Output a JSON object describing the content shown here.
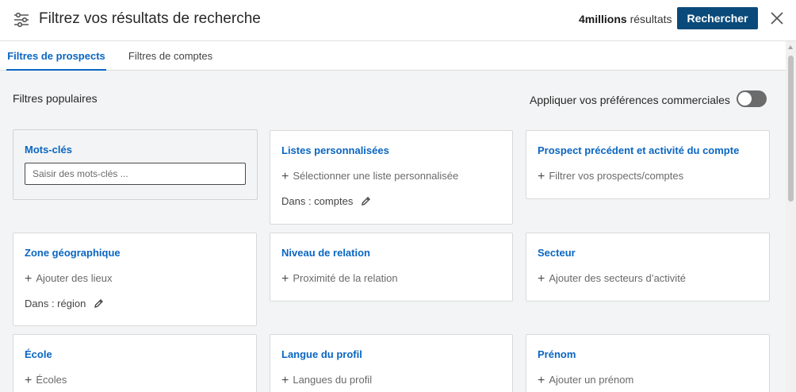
{
  "header": {
    "title": "Filtrez vos résultats de recherche",
    "results_count": "4millions",
    "results_suffix": "résultats",
    "search_label": "Rechercher"
  },
  "tabs": [
    {
      "label": "Filtres de prospects",
      "active": true
    },
    {
      "label": "Filtres de comptes",
      "active": false
    }
  ],
  "section": {
    "title": "Filtres populaires",
    "preference_label": "Appliquer vos préférences commerciales",
    "preference_enabled": false
  },
  "cards": {
    "keywords": {
      "title": "Mots-clés",
      "placeholder": "Saisir des mots-clés ..."
    },
    "custom_lists": {
      "title": "Listes personnalisées",
      "add_label": "Sélectionner une liste personnalisée",
      "scope": "Dans : comptes"
    },
    "previous_activity": {
      "title": "Prospect précédent et activité du compte",
      "add_label": "Filtrer vos prospects/comptes"
    },
    "geography": {
      "title": "Zone géographique",
      "add_label": "Ajouter des lieux",
      "scope": "Dans : région"
    },
    "relationship": {
      "title": "Niveau de relation",
      "add_label": "Proximité de la relation"
    },
    "sector": {
      "title": "Secteur",
      "add_label": "Ajouter des secteurs d’activité"
    },
    "school": {
      "title": "École",
      "add_label": "Écoles"
    },
    "profile_language": {
      "title": "Langue du profil",
      "add_label": "Langues du profil"
    },
    "first_name": {
      "title": "Prénom",
      "add_label": "Ajouter un prénom"
    }
  },
  "colors": {
    "accent": "#0a66c2",
    "primary_button": "#0a4a7a",
    "toggle_off": "#6b6b6b"
  },
  "icons": [
    "sliders-icon",
    "close-icon",
    "plus-icon",
    "pencil-icon"
  ]
}
